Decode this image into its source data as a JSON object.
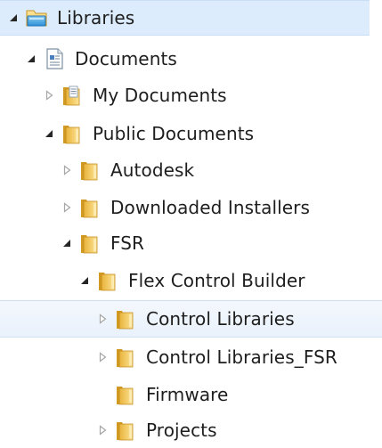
{
  "tree": {
    "items": [
      {
        "label": "Libraries",
        "icon": "libraries-icon",
        "expander": "expanded",
        "level": 0,
        "state": "selected"
      },
      {
        "label": "Documents",
        "icon": "document-library-icon",
        "expander": "expanded",
        "level": 1,
        "state": "normal"
      },
      {
        "label": "My Documents",
        "icon": "my-documents-folder-icon",
        "expander": "collapsed",
        "level": 2,
        "state": "normal"
      },
      {
        "label": "Public Documents",
        "icon": "folder-icon",
        "expander": "expanded",
        "level": 2,
        "state": "normal"
      },
      {
        "label": "Autodesk",
        "icon": "folder-icon",
        "expander": "collapsed",
        "level": 3,
        "state": "normal"
      },
      {
        "label": "Downloaded Installers",
        "icon": "folder-icon",
        "expander": "collapsed",
        "level": 3,
        "state": "normal"
      },
      {
        "label": "FSR",
        "icon": "folder-icon",
        "expander": "expanded",
        "level": 3,
        "state": "normal"
      },
      {
        "label": "Flex Control Builder",
        "icon": "folder-icon",
        "expander": "expanded",
        "level": 4,
        "state": "normal"
      },
      {
        "label": "Control Libraries",
        "icon": "folder-icon",
        "expander": "collapsed",
        "level": 5,
        "state": "hover"
      },
      {
        "label": "Control Libraries_FSR",
        "icon": "folder-icon",
        "expander": "collapsed",
        "level": 5,
        "state": "normal"
      },
      {
        "label": "Firmware",
        "icon": "folder-icon",
        "expander": "none",
        "level": 5,
        "state": "normal"
      },
      {
        "label": "Projects",
        "icon": "folder-icon",
        "expander": "collapsed",
        "level": 5,
        "state": "normal"
      }
    ]
  }
}
